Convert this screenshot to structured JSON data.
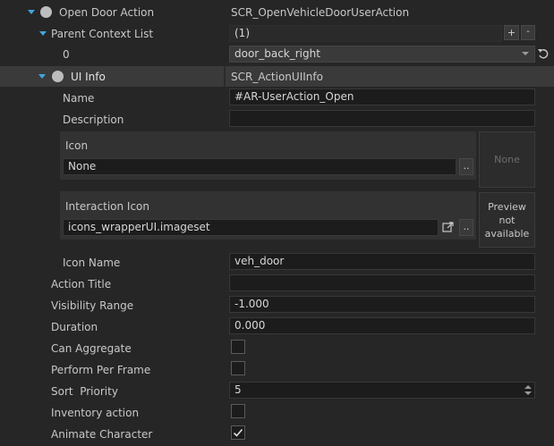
{
  "open_door": {
    "label": "Open Door Action",
    "class": "SCR_OpenVehicleDoorUserAction"
  },
  "parent_context": {
    "label": "Parent Context List",
    "count": "(1)",
    "add_btn": "+",
    "remove_btn": "-"
  },
  "context_item": {
    "index": "0",
    "value": "door_back_right"
  },
  "ui_info": {
    "label": "UI Info",
    "class": "SCR_ActionUIInfo"
  },
  "fields": {
    "name": {
      "label": "Name",
      "value": "#AR-UserAction_Open"
    },
    "description": {
      "label": "Description",
      "value": ""
    },
    "icon": {
      "label": "Icon",
      "value": "None",
      "browse": "..",
      "preview": "None"
    },
    "interaction_icon": {
      "label": "Interaction Icon",
      "value": "icons_wrapperUI.imageset",
      "browse": "..",
      "preview": "Preview not available"
    },
    "icon_name": {
      "label": "Icon Name",
      "value": "veh_door"
    },
    "action_title": {
      "label": "Action Title",
      "value": ""
    },
    "visibility_range": {
      "label": "Visibility Range",
      "value": "-1.000"
    },
    "duration": {
      "label": "Duration",
      "value": "0.000"
    },
    "can_aggregate": {
      "label": "Can Aggregate",
      "checked": false
    },
    "perform_per_frame": {
      "label": "Perform Per Frame",
      "checked": false
    },
    "sort_priority": {
      "label": "Sort  Priority",
      "value": "5"
    },
    "inventory_action": {
      "label": "Inventory action",
      "checked": false
    },
    "animate_character": {
      "label": "Animate Character",
      "checked": true
    }
  },
  "colors": {
    "accent": "#3ea6e0",
    "background": "#262626",
    "field": "#1c1c1c",
    "selected_row": "#3a3a3a"
  }
}
